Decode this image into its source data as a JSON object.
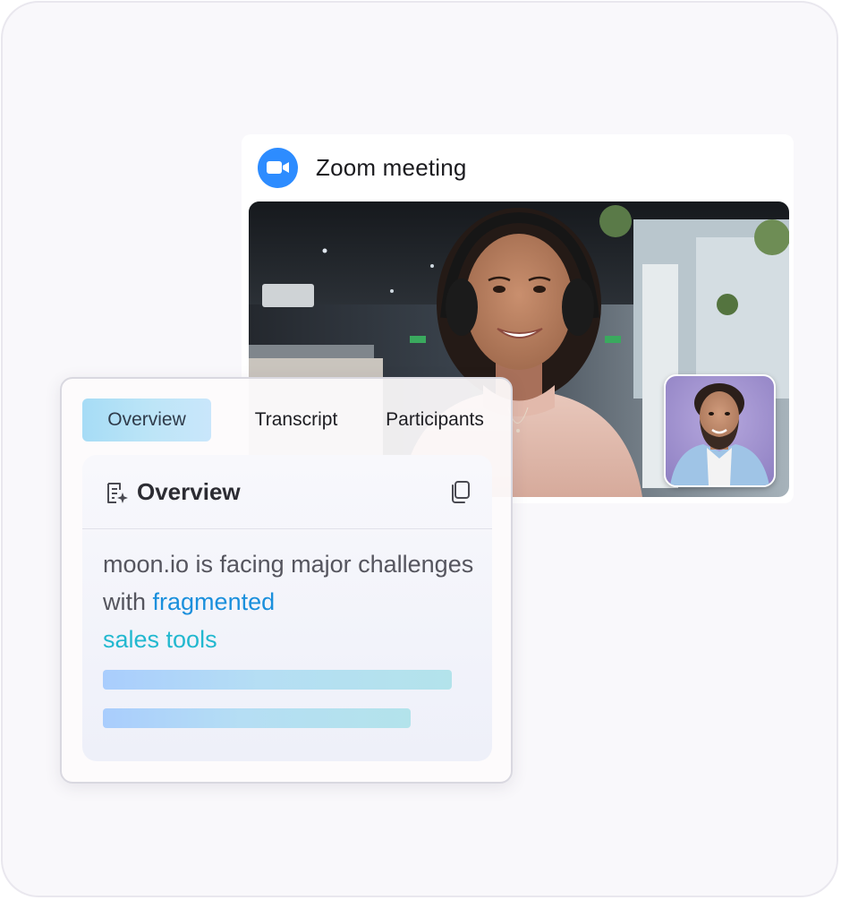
{
  "zoom": {
    "title": "Zoom meeting",
    "logo_icon": "video-camera-icon",
    "brand_color": "#2d8cff"
  },
  "video": {
    "main_participant": "woman-with-headphones-video",
    "pip_participant": "bearded-man-video"
  },
  "panel": {
    "tabs": [
      {
        "label": "Overview",
        "active": true
      },
      {
        "label": "Transcript",
        "active": false
      },
      {
        "label": "Participants",
        "active": false
      }
    ],
    "card": {
      "title": "Overview",
      "title_icon": "ai-document-icon",
      "copy_icon": "copy-icon",
      "summary_plain": "moon.io is facing major challenges with ",
      "summary_highlight_1": "fragmented",
      "summary_highlight_2": "sales tools",
      "highlight_colors": [
        "#1a8fdc",
        "#22b8cf"
      ]
    }
  }
}
